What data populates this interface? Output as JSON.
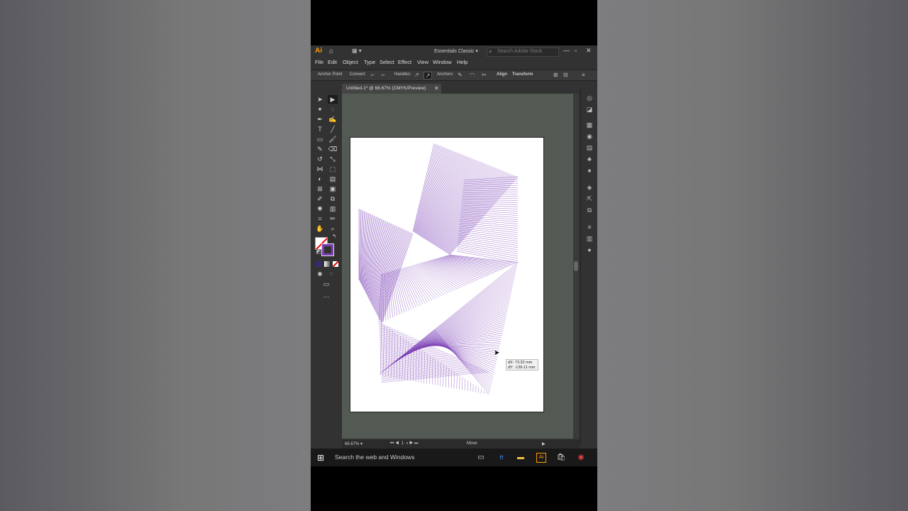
{
  "app": {
    "logo": "Ai",
    "workspace": "Essentials Classic",
    "search_placeholder": "Search Adobe Stock",
    "window_controls": [
      "—",
      "▫",
      "✕"
    ]
  },
  "menu": [
    "File",
    "Edit",
    "Object",
    "Type",
    "Select",
    "Effect",
    "View",
    "Window",
    "Help"
  ],
  "control_bar": {
    "anchor_point": "Anchor Point",
    "convert": "Convert:",
    "handles": "Handles:",
    "anchors": "Anchors:",
    "align": "Align",
    "transform": "Transform"
  },
  "document": {
    "tab_label": "Untitled-1* @ 66.67% (CMYK/Preview)",
    "close": "✕"
  },
  "tooltip": {
    "dx": "dX: 73.32 mm",
    "dy": "dY: -139.11 mm"
  },
  "status": {
    "zoom": "66.67%",
    "page": "1",
    "tool": "Move"
  },
  "taskbar": {
    "search": "Search the web and Windows"
  },
  "colors": {
    "accent": "#7b3fb5",
    "ai_orange": "#ff9a00"
  }
}
